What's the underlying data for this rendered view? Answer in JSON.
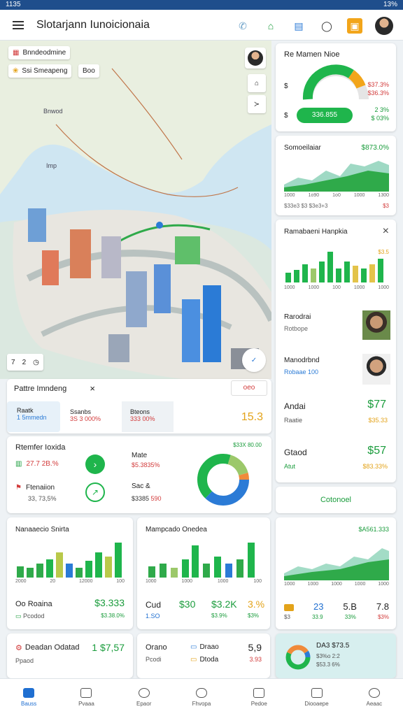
{
  "status": {
    "time": "1135",
    "battery": "13%"
  },
  "appbar": {
    "title": "Slotarjann Iunoicionaia"
  },
  "map": {
    "chip1": "Bnndeodmine",
    "chip2": "Ssi Smeapeng",
    "chip2b": "Boo",
    "label_a": "Bnwod",
    "label_b": "Imp",
    "controls": [
      "7",
      "2"
    ]
  },
  "tabs": {
    "title": "Pattre Imndeng",
    "close": "×",
    "alt_btn": "oeo",
    "items": [
      {
        "label": "Raatk",
        "value": "1 5mmedn"
      },
      {
        "label": "Ssanbs",
        "value": "3S 3 000%"
      },
      {
        "label": "Bteons",
        "value": "333 00%"
      }
    ],
    "big_value": "15.3"
  },
  "summary": {
    "title": "Rtemfer Ioxida",
    "rows": [
      {
        "label": "27.7 2B.%",
        "value_label": "Mate",
        "value": "$5.3835%"
      },
      {
        "label": "Ftenaiion",
        "sub": "33, 73,5%",
        "value_label": "Sac &",
        "value": "$3385"
      },
      {
        "extra": "590"
      }
    ],
    "donut_label": "$33X 80.00"
  },
  "panel_gauge": {
    "title": "Re Mamen Nioe",
    "left_values": [
      "$",
      "$"
    ],
    "right_values": [
      "$37.3%",
      "$36.3%"
    ],
    "button": "336.855",
    "bottom_right": [
      "2 3%",
      "$ 03%"
    ]
  },
  "panel_area": {
    "title": "Somoeilaiar",
    "value": "$873.0%",
    "x_labels": [
      "1000",
      "1o90",
      "1o0",
      "1000",
      "1300"
    ],
    "footer": "$33e3 $3 $3e3+3",
    "footer_r": "$3"
  },
  "panel_list": {
    "title": "Ramabaeni Hanpkia",
    "close": "×",
    "chart_tick": "$3.5",
    "x_labels": [
      "1000",
      "1000",
      "100",
      "1000",
      "1000"
    ],
    "people": [
      {
        "name": "Rarodrai",
        "role": "Rotbope"
      },
      {
        "name": "Manodrbnd",
        "role": "Robaae 100"
      }
    ],
    "rows": [
      {
        "label": "Andai",
        "sub": "Raatie",
        "value": "$77",
        "delta": "$35.33"
      },
      {
        "label": "Gtaod",
        "sub": "Atut",
        "value": "$57",
        "delta": "$83.33%"
      }
    ],
    "button": "Cotonoel"
  },
  "card_bars1": {
    "title": "Nanaaecio Snirta",
    "x_labels": [
      "2000",
      "20",
      "12000",
      "100"
    ],
    "bottom_label": "Oo Roaina",
    "bottom_sub": "Pcodod",
    "value": "$3.333",
    "delta": "$3.38.0%"
  },
  "card_bars2": {
    "title": "Mampcado Onedea",
    "x_labels": [
      "1000",
      "1000",
      "1000",
      "100"
    ],
    "label": "Cud",
    "sub": "1.SO",
    "v1": "$30",
    "v2": "$3.2K",
    "v3": "3.%",
    "sub2": "$3.9%",
    "sub3": "$3%"
  },
  "card_area2": {
    "value": "$A561.333",
    "x_labels": [
      "1000",
      "1000",
      "1000",
      "1000",
      "1000"
    ],
    "v1": "23",
    "v2": "5.B",
    "v3": "7.8",
    "s1": "$3",
    "s2": "33.9",
    "s3": "33%",
    "s4": "$3%"
  },
  "bottom_cards": {
    "c1": {
      "title": "Deadan Odatad",
      "value": "1 $7,57",
      "sub": "Ppaod"
    },
    "c2": {
      "label": "Orano",
      "sub": "Pcodi",
      "item1": "Draao",
      "item2": "Dtoda",
      "value": "5,9",
      "delta": "3.93"
    },
    "c3": {
      "value": "DA3 $73.5",
      "sub1": "$3%o 2:2",
      "sub2": "$53.3 6%"
    }
  },
  "nav": [
    {
      "label": "Bauss"
    },
    {
      "label": "Pvaaa"
    },
    {
      "label": "Epaor"
    },
    {
      "label": "Fhvopa"
    },
    {
      "label": "Pedoe"
    },
    {
      "label": "Diooaepe"
    },
    {
      "label": "Aeaac"
    }
  ],
  "colors": {
    "green": "#1fb54c",
    "blue": "#2b7bd6",
    "accent": "#1f4e8c"
  }
}
